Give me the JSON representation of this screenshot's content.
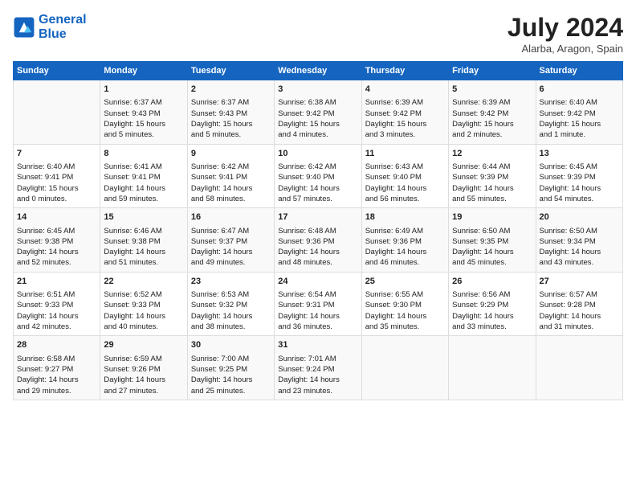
{
  "logo": {
    "line1": "General",
    "line2": "Blue"
  },
  "title": "July 2024",
  "subtitle": "Alarba, Aragon, Spain",
  "header_days": [
    "Sunday",
    "Monday",
    "Tuesday",
    "Wednesday",
    "Thursday",
    "Friday",
    "Saturday"
  ],
  "weeks": [
    [
      {
        "day": "",
        "content": ""
      },
      {
        "day": "1",
        "content": "Sunrise: 6:37 AM\nSunset: 9:43 PM\nDaylight: 15 hours\nand 5 minutes."
      },
      {
        "day": "2",
        "content": "Sunrise: 6:37 AM\nSunset: 9:43 PM\nDaylight: 15 hours\nand 5 minutes."
      },
      {
        "day": "3",
        "content": "Sunrise: 6:38 AM\nSunset: 9:42 PM\nDaylight: 15 hours\nand 4 minutes."
      },
      {
        "day": "4",
        "content": "Sunrise: 6:39 AM\nSunset: 9:42 PM\nDaylight: 15 hours\nand 3 minutes."
      },
      {
        "day": "5",
        "content": "Sunrise: 6:39 AM\nSunset: 9:42 PM\nDaylight: 15 hours\nand 2 minutes."
      },
      {
        "day": "6",
        "content": "Sunrise: 6:40 AM\nSunset: 9:42 PM\nDaylight: 15 hours\nand 1 minute."
      }
    ],
    [
      {
        "day": "7",
        "content": "Sunrise: 6:40 AM\nSunset: 9:41 PM\nDaylight: 15 hours\nand 0 minutes."
      },
      {
        "day": "8",
        "content": "Sunrise: 6:41 AM\nSunset: 9:41 PM\nDaylight: 14 hours\nand 59 minutes."
      },
      {
        "day": "9",
        "content": "Sunrise: 6:42 AM\nSunset: 9:41 PM\nDaylight: 14 hours\nand 58 minutes."
      },
      {
        "day": "10",
        "content": "Sunrise: 6:42 AM\nSunset: 9:40 PM\nDaylight: 14 hours\nand 57 minutes."
      },
      {
        "day": "11",
        "content": "Sunrise: 6:43 AM\nSunset: 9:40 PM\nDaylight: 14 hours\nand 56 minutes."
      },
      {
        "day": "12",
        "content": "Sunrise: 6:44 AM\nSunset: 9:39 PM\nDaylight: 14 hours\nand 55 minutes."
      },
      {
        "day": "13",
        "content": "Sunrise: 6:45 AM\nSunset: 9:39 PM\nDaylight: 14 hours\nand 54 minutes."
      }
    ],
    [
      {
        "day": "14",
        "content": "Sunrise: 6:45 AM\nSunset: 9:38 PM\nDaylight: 14 hours\nand 52 minutes."
      },
      {
        "day": "15",
        "content": "Sunrise: 6:46 AM\nSunset: 9:38 PM\nDaylight: 14 hours\nand 51 minutes."
      },
      {
        "day": "16",
        "content": "Sunrise: 6:47 AM\nSunset: 9:37 PM\nDaylight: 14 hours\nand 49 minutes."
      },
      {
        "day": "17",
        "content": "Sunrise: 6:48 AM\nSunset: 9:36 PM\nDaylight: 14 hours\nand 48 minutes."
      },
      {
        "day": "18",
        "content": "Sunrise: 6:49 AM\nSunset: 9:36 PM\nDaylight: 14 hours\nand 46 minutes."
      },
      {
        "day": "19",
        "content": "Sunrise: 6:50 AM\nSunset: 9:35 PM\nDaylight: 14 hours\nand 45 minutes."
      },
      {
        "day": "20",
        "content": "Sunrise: 6:50 AM\nSunset: 9:34 PM\nDaylight: 14 hours\nand 43 minutes."
      }
    ],
    [
      {
        "day": "21",
        "content": "Sunrise: 6:51 AM\nSunset: 9:33 PM\nDaylight: 14 hours\nand 42 minutes."
      },
      {
        "day": "22",
        "content": "Sunrise: 6:52 AM\nSunset: 9:33 PM\nDaylight: 14 hours\nand 40 minutes."
      },
      {
        "day": "23",
        "content": "Sunrise: 6:53 AM\nSunset: 9:32 PM\nDaylight: 14 hours\nand 38 minutes."
      },
      {
        "day": "24",
        "content": "Sunrise: 6:54 AM\nSunset: 9:31 PM\nDaylight: 14 hours\nand 36 minutes."
      },
      {
        "day": "25",
        "content": "Sunrise: 6:55 AM\nSunset: 9:30 PM\nDaylight: 14 hours\nand 35 minutes."
      },
      {
        "day": "26",
        "content": "Sunrise: 6:56 AM\nSunset: 9:29 PM\nDaylight: 14 hours\nand 33 minutes."
      },
      {
        "day": "27",
        "content": "Sunrise: 6:57 AM\nSunset: 9:28 PM\nDaylight: 14 hours\nand 31 minutes."
      }
    ],
    [
      {
        "day": "28",
        "content": "Sunrise: 6:58 AM\nSunset: 9:27 PM\nDaylight: 14 hours\nand 29 minutes."
      },
      {
        "day": "29",
        "content": "Sunrise: 6:59 AM\nSunset: 9:26 PM\nDaylight: 14 hours\nand 27 minutes."
      },
      {
        "day": "30",
        "content": "Sunrise: 7:00 AM\nSunset: 9:25 PM\nDaylight: 14 hours\nand 25 minutes."
      },
      {
        "day": "31",
        "content": "Sunrise: 7:01 AM\nSunset: 9:24 PM\nDaylight: 14 hours\nand 23 minutes."
      },
      {
        "day": "",
        "content": ""
      },
      {
        "day": "",
        "content": ""
      },
      {
        "day": "",
        "content": ""
      }
    ]
  ]
}
